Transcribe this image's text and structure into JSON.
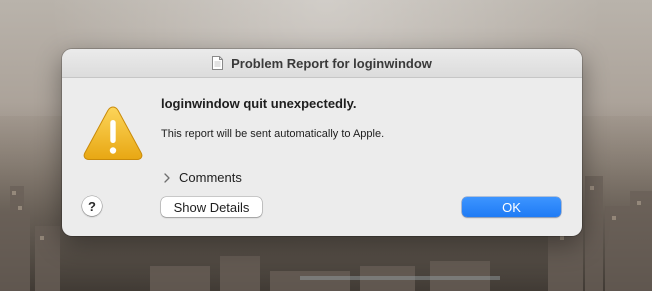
{
  "window": {
    "title": "Problem Report for loginwindow",
    "title_icon": "document-icon"
  },
  "alert": {
    "icon": "warning-triangle-icon",
    "icon_color": "#f2b81e",
    "headline": "loginwindow quit unexpectedly.",
    "message": "This report will be sent automatically to Apple."
  },
  "comments": {
    "label": "Comments",
    "expanded": false
  },
  "buttons": {
    "help_label": "?",
    "details_label": "Show Details",
    "ok_label": "OK",
    "ok_color": "#1f7bf5"
  }
}
